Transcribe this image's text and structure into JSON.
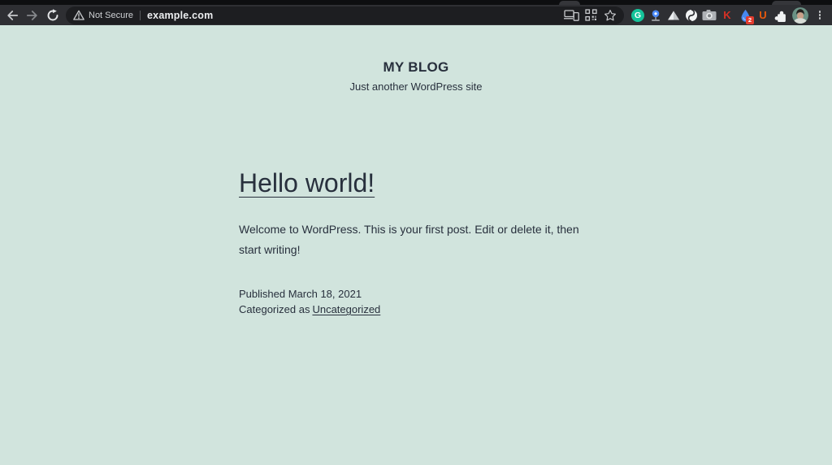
{
  "browser": {
    "omnibox": {
      "security_warning_label": "Not Secure",
      "url": "example.com"
    },
    "extensions": [
      {
        "name": "grammarly",
        "glyph": "G",
        "badge": ""
      },
      {
        "name": "blue-figure",
        "glyph": "",
        "badge": ""
      },
      {
        "name": "triangle",
        "glyph": "",
        "badge": ""
      },
      {
        "name": "swirl",
        "glyph": "",
        "badge": ""
      },
      {
        "name": "camera",
        "glyph": "",
        "badge": ""
      },
      {
        "name": "letter-k",
        "glyph": "K",
        "badge": ""
      },
      {
        "name": "blue-drop",
        "glyph": "",
        "badge": "2"
      },
      {
        "name": "letter-u",
        "glyph": "U",
        "badge": ""
      },
      {
        "name": "extensions-puzzle",
        "glyph": "",
        "badge": ""
      }
    ],
    "colors": {
      "toolbar": "#2e2f33",
      "omnibox": "#1d1e21",
      "tabstrip": "#0d0e10"
    }
  },
  "page": {
    "header": {
      "site_title": "MY BLOG",
      "tagline": "Just another WordPress site"
    },
    "post": {
      "title": "Hello world!",
      "body_line1": "Welcome to WordPress. This is your first post. Edit or delete it, then",
      "body_line2": "start writing!",
      "published": "Published March 18, 2021",
      "categorized_prefix": "Categorized as",
      "category": "Uncategorized"
    },
    "colors": {
      "background": "#d1e4dd",
      "text": "#28303d"
    }
  }
}
